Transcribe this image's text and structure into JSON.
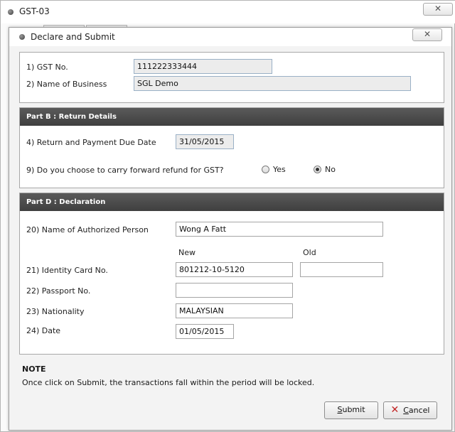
{
  "window": {
    "title": "GST-03",
    "close_glyph": "✕"
  },
  "dialog": {
    "title": "Declare and Submit",
    "close_glyph": "✕"
  },
  "part_a": {
    "gst_no_label": "1) GST No.",
    "gst_no_value": "111222333444",
    "business_label": "2) Name of Business",
    "business_value": "SGL Demo"
  },
  "part_b": {
    "header": "Part B : Return Details",
    "due_date_label": "4) Return and Payment Due Date",
    "due_date_value": "31/05/2015",
    "refund_question": "9) Do you choose to carry forward refund for GST?",
    "refund_options": [
      {
        "label": "Yes",
        "checked": false
      },
      {
        "label": "No",
        "checked": true
      }
    ]
  },
  "part_d": {
    "header": "Part D : Declaration",
    "authorized_label": "20) Name of Authorized Person",
    "authorized_value": "Wong A Fatt",
    "col_new": "New",
    "col_old": "Old",
    "ic_label": "21) Identity Card No.",
    "ic_new_value": "801212-10-5120",
    "ic_old_value": "",
    "passport_label": "22) Passport No.",
    "passport_value": "",
    "nationality_label": "23) Nationality",
    "nationality_value": "MALAYSIAN",
    "date_label": "24) Date",
    "date_value": "01/05/2015"
  },
  "note": {
    "title": "NOTE",
    "text": "Once click on Submit, the transactions fall within the period will be locked."
  },
  "buttons": {
    "submit_hotkey": "S",
    "submit_rest": "ubmit",
    "cancel_glyph": "✕",
    "cancel_hotkey": "C",
    "cancel_rest": "ancel"
  }
}
